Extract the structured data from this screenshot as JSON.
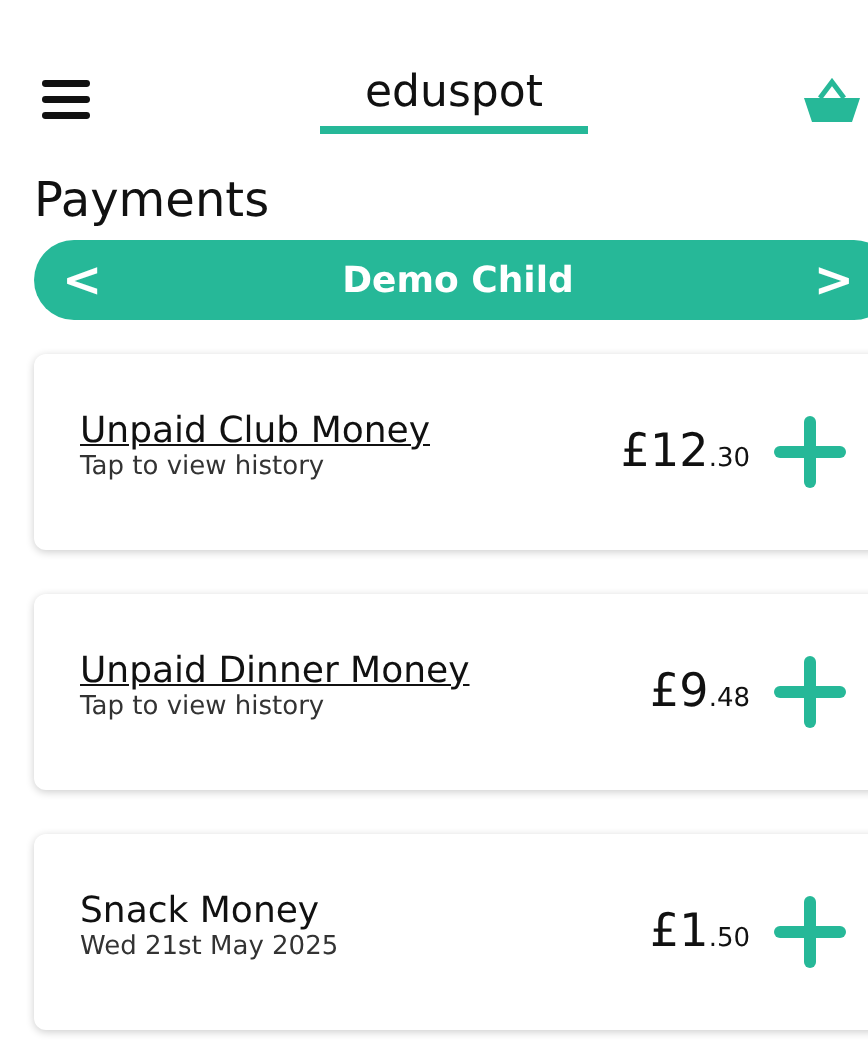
{
  "header": {
    "logo": "eduspot"
  },
  "title": "Payments",
  "child_selector": {
    "prev": "<",
    "name": "Demo Child",
    "next": ">"
  },
  "items": [
    {
      "title": "Unpaid Club Money",
      "underlined": true,
      "subtitle": "Tap to view history",
      "amount_whole": "£12",
      "amount_pence": ".30"
    },
    {
      "title": "Unpaid Dinner Money",
      "underlined": true,
      "subtitle": "Tap to view history",
      "amount_whole": "£9",
      "amount_pence": ".48"
    },
    {
      "title": "Snack Money",
      "underlined": false,
      "subtitle": "Wed 21st May 2025",
      "amount_whole": "£1",
      "amount_pence": ".50"
    }
  ]
}
